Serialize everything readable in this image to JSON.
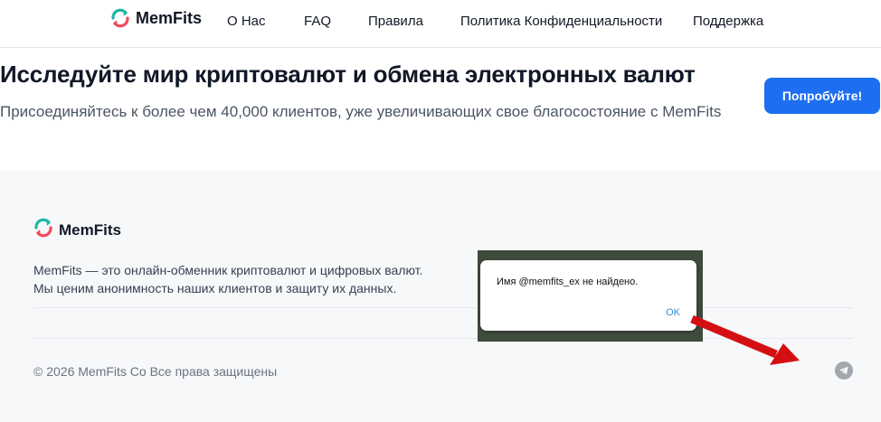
{
  "nav": {
    "brand": "MemFits",
    "links": [
      "О Нас",
      "FAQ",
      "Правила",
      "Политика Конфиденциальности",
      "Поддержка"
    ]
  },
  "hero": {
    "title": "Исследуйте мир криптовалют и обмена электронных валют",
    "subtitle": "Присоединяйтесь к более чем 40,000 клиентов, уже увеличивающих свое благосостояние с MemFits",
    "cta": "Попробуйте!"
  },
  "footer": {
    "brand": "MemFits",
    "desc_line1": "MemFits — это онлайн-обменник криптовалют и цифровых валют.",
    "desc_line2": "Мы ценим анонимность наших клиентов и защиту их данных.",
    "copyright": "© 2026 MemFits Co Все права защищены",
    "social_icon": "telegram-icon"
  },
  "dialog": {
    "message": "Имя @memfits_ex не найдено.",
    "ok": "OK"
  },
  "colors": {
    "accent": "#1d6ef0",
    "logo_teal": "#1fb8a4",
    "logo_red": "#ef4d5b",
    "annotation_arrow": "#d40f12"
  }
}
